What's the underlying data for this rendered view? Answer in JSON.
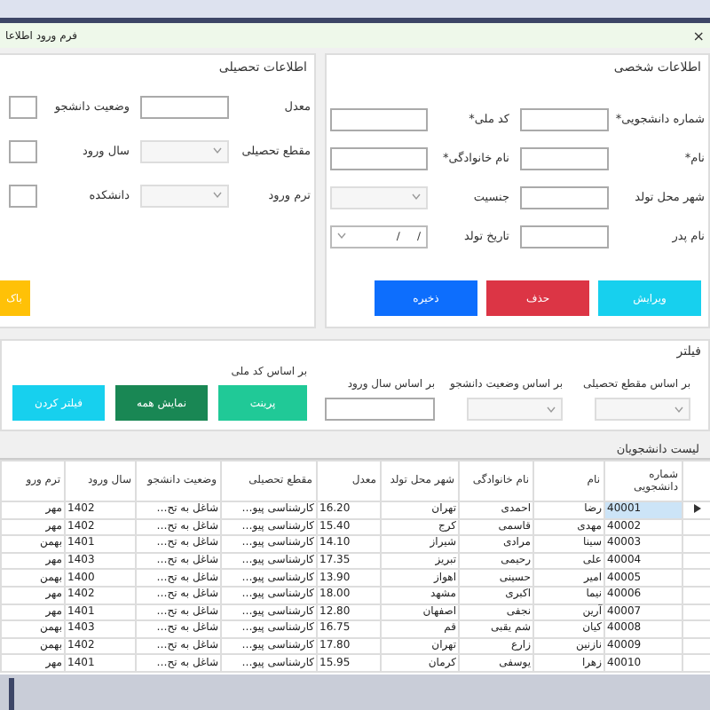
{
  "window": {
    "title": "فرم ورود اطلاعا",
    "close": "×"
  },
  "academic": {
    "legend": "اطلاعات تحصیلی",
    "fields": [
      {
        "label": "معدل",
        "kind": "text"
      },
      {
        "label": "وضعیت دانشجو",
        "kind": "text"
      },
      {
        "label": "مقطع تحصیلی",
        "kind": "select"
      },
      {
        "label": "سال ورود",
        "kind": "text"
      },
      {
        "label": "ترم ورود",
        "kind": "select"
      },
      {
        "label": "دانشکده",
        "kind": "text"
      }
    ],
    "buttons": [
      {
        "label": "باک",
        "color": "#ffc107"
      }
    ]
  },
  "personal": {
    "legend": "اطلاعات شخصی",
    "fields": [
      {
        "label": "شماره دانشجویی*",
        "kind": "text"
      },
      {
        "label": "کد ملی*",
        "kind": "text"
      },
      {
        "label": "نام*",
        "kind": "text"
      },
      {
        "label": "نام خانوادگی*",
        "kind": "text"
      },
      {
        "label": "شهر محل تولد",
        "kind": "text"
      },
      {
        "label": "جنسیت",
        "kind": "select"
      },
      {
        "label": "نام پدر",
        "kind": "text"
      },
      {
        "label": "تاریخ تولد",
        "kind": "date",
        "value": "/     /"
      }
    ],
    "buttons": [
      {
        "label": "ویرایش",
        "color": "#17d0ee"
      },
      {
        "label": "حذف",
        "color": "#dc3545"
      },
      {
        "label": "ذخیره",
        "color": "#0d6efd"
      }
    ]
  },
  "filter": {
    "legend": "فیلتر",
    "fields": [
      {
        "label": "بر اساس مقطع تحصیلی",
        "kind": "select"
      },
      {
        "label": "بر اساس وضعیت دانشجو",
        "kind": "select"
      },
      {
        "label": "بر اساس سال ورود",
        "kind": "text"
      }
    ],
    "extra_label": "بر اساس کد ملی",
    "buttons": [
      {
        "label": "پرینت",
        "color": "#20c997"
      },
      {
        "label": "نمایش همه",
        "color": "#198754"
      },
      {
        "label": "فیلتر کردن",
        "color": "#17d0ee"
      }
    ]
  },
  "table": {
    "title": "لیست دانشجویان",
    "columns": [
      "شماره دانشجویی",
      "نام",
      "نام خانوادگی",
      "شهر محل تولد",
      "معدل",
      "مقطع تحصیلی",
      "وضعیت دانشجو",
      "سال ورود",
      "ترم ورو"
    ],
    "rows": [
      {
        "selected": true,
        "cells": [
          "40001",
          "رضا",
          "احمدی",
          "تهران",
          "16.20",
          "کارشناسی پیو…",
          "شاغل به تح…",
          "1402",
          "مهر"
        ]
      },
      {
        "selected": false,
        "cells": [
          "40002",
          "مهدی",
          "قاسمی",
          "کرج",
          "15.40",
          "کارشناسی پیو…",
          "شاغل به تح…",
          "1402",
          "مهر"
        ]
      },
      {
        "selected": false,
        "cells": [
          "40003",
          "سینا",
          "مرادی",
          "شیراز",
          "14.10",
          "کارشناسی پیو…",
          "شاغل به تح…",
          "1401",
          "بهمن"
        ]
      },
      {
        "selected": false,
        "cells": [
          "40004",
          "علی",
          "رحیمی",
          "تبریز",
          "17.35",
          "کارشناسی پیو…",
          "شاغل به تح…",
          "1403",
          "مهر"
        ]
      },
      {
        "selected": false,
        "cells": [
          "40005",
          "امیر",
          "حسینی",
          "اهواز",
          "13.90",
          "کارشناسی پیو…",
          "شاغل به تح…",
          "1400",
          "بهمن"
        ]
      },
      {
        "selected": false,
        "cells": [
          "40006",
          "نیما",
          "اکبری",
          "مشهد",
          "18.00",
          "کارشناسی پیو…",
          "شاغل به تح…",
          "1402",
          "مهر"
        ]
      },
      {
        "selected": false,
        "cells": [
          "40007",
          "آرین",
          "نجفی",
          "اصفهان",
          "12.80",
          "کارشناسی پیو…",
          "شاغل به تح…",
          "1401",
          "مهر"
        ]
      },
      {
        "selected": false,
        "cells": [
          "40008",
          "کیان",
          "شم یقبی",
          "قم",
          "16.75",
          "کارشناسی پیو…",
          "شاغل به تح…",
          "1403",
          "بهمن"
        ]
      },
      {
        "selected": false,
        "cells": [
          "40009",
          "نازنین",
          "زارع",
          "تهران",
          "17.80",
          "کارشناسی پیو…",
          "شاغل به تح…",
          "1402",
          "بهمن"
        ]
      },
      {
        "selected": false,
        "cells": [
          "40010",
          "زهرا",
          "یوسفی",
          "کرمان",
          "15.95",
          "کارشناسی پیو…",
          "شاغل به تح…",
          "1401",
          "مهر"
        ]
      }
    ]
  }
}
